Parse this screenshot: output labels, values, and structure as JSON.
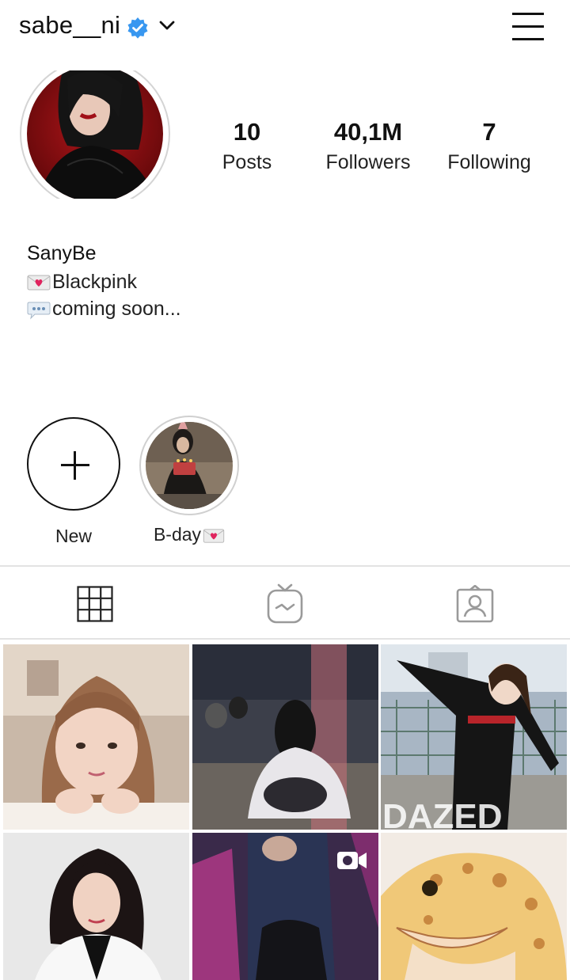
{
  "header": {
    "username": "sabe__ni",
    "verified_icon": "verified-badge-icon",
    "dropdown_icon": "chevron-down-icon",
    "menu_icon": "hamburger-menu-icon"
  },
  "stats": {
    "posts": {
      "value": "10",
      "label": "Posts"
    },
    "followers": {
      "value": "40,1M",
      "label": "Followers"
    },
    "following": {
      "value": "7",
      "label": "Following"
    }
  },
  "bio": {
    "name": "SanyBe",
    "lines": [
      {
        "emoji": "love-letter-emoji",
        "text": "Blackpink"
      },
      {
        "emoji": "speech-bubble-emoji",
        "text": "coming soon..."
      }
    ]
  },
  "highlights": [
    {
      "label": "New",
      "icon": "plus-icon"
    },
    {
      "label": "B-day",
      "emoji": "love-letter-emoji"
    }
  ],
  "tabs": [
    {
      "name": "grid-tab",
      "icon": "grid-icon",
      "active": true
    },
    {
      "name": "igtv-tab",
      "icon": "igtv-icon",
      "active": false
    },
    {
      "name": "tagged-tab",
      "icon": "tagged-person-icon",
      "active": false
    }
  ],
  "posts_grid": [
    {
      "kind": "photo"
    },
    {
      "kind": "photo"
    },
    {
      "kind": "photo",
      "watermark": "DAZED"
    },
    {
      "kind": "photo"
    },
    {
      "kind": "video",
      "icon": "video-camera-icon"
    },
    {
      "kind": "photo"
    }
  ],
  "colors": {
    "verified": "#3897f0",
    "text": "#111111",
    "divider": "#e3e3e3",
    "inactive_icon": "#9a9a9a"
  }
}
